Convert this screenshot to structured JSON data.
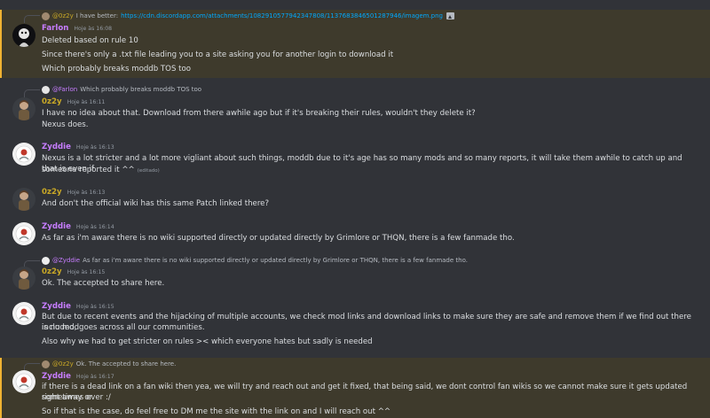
{
  "colors": {
    "zyddie": "#c77dff",
    "oz2y": "#c9a826",
    "farlon": "#c77dff",
    "link": "#00a8fc",
    "highlight": "#f0b232"
  },
  "messages": [
    {
      "reply_to": "@0z2y",
      "reply_text": "I have better:",
      "reply_link": "https://cdn.discordapp.com/attachments/1082910577942347808/1137683846501287946/imagem.png",
      "author": "Farlon",
      "time": "Hoje às 16:08",
      "lines": [
        "Deleted based on rule 10",
        "Since there's only a .txt file leading you to a site asking you for another login to download it",
        "Which probably breaks moddb TOS too"
      ]
    },
    {
      "reply_to": "@Farlon",
      "reply_text": "Which probably breaks moddb TOS too",
      "author": "0z2y",
      "time": "Hoje às 16:11",
      "lines": [
        "I have no idea about that. Download from there awhile ago but if it's breaking their rules, wouldn't they delete it?",
        "Nexus does."
      ]
    },
    {
      "author": "Zyddie",
      "time": "Hoje às 16:13",
      "lines": [
        "Nexus is a lot stricter and a lot more vigliant about such things, moddb due to it's age has so many mods and so many reports, it will take them awhile to catch up and that is even if",
        "someone reported it ^^"
      ],
      "edited": "(editado)"
    },
    {
      "author": "0z2y",
      "time": "Hoje às 16:13",
      "lines": [
        "And don't the official wiki has this same Patch linked there?"
      ]
    },
    {
      "author": "Zyddie",
      "time": "Hoje às 16:14",
      "lines": [
        "As far as i'm aware there is no wiki supported directly or updated directly by Grimlore or THQN, there is a few fanmade tho."
      ]
    },
    {
      "reply_to": "@Zyddie",
      "reply_text": "As far as i'm aware there is no wiki supported directly or updated directly by Grimlore or THQN, there is a few fanmade tho.",
      "author": "0z2y",
      "time": "Hoje às 16:15",
      "lines": [
        "Ok. The accepted to share here."
      ]
    },
    {
      "author": "Zyddie",
      "time": "Hoje às 16:15",
      "lines": [
        "But due to recent events and the hijacking of multiple accounts, we check mod links and download links to make sure they are safe and remove them if we find out there is no mod",
        "included, goes across all our communities.",
        "Also why we had to get stricter on rules >< which everyone hates but sadly is needed"
      ]
    },
    {
      "reply_to": "@0z2y",
      "reply_text": "Ok. The accepted to share here.",
      "author": "Zyddie",
      "time": "Hoje às 16:17",
      "lines": [
        "if there is a dead link on a fan wiki then yea, we will try and reach out and get it fixed, that being said, we dont control fan wikis so we cannot make sure it gets updated right away or",
        "sometimes ever :/",
        "So if that is the case, do feel free to DM me the site with the link on and I will reach out ^^"
      ]
    }
  ]
}
